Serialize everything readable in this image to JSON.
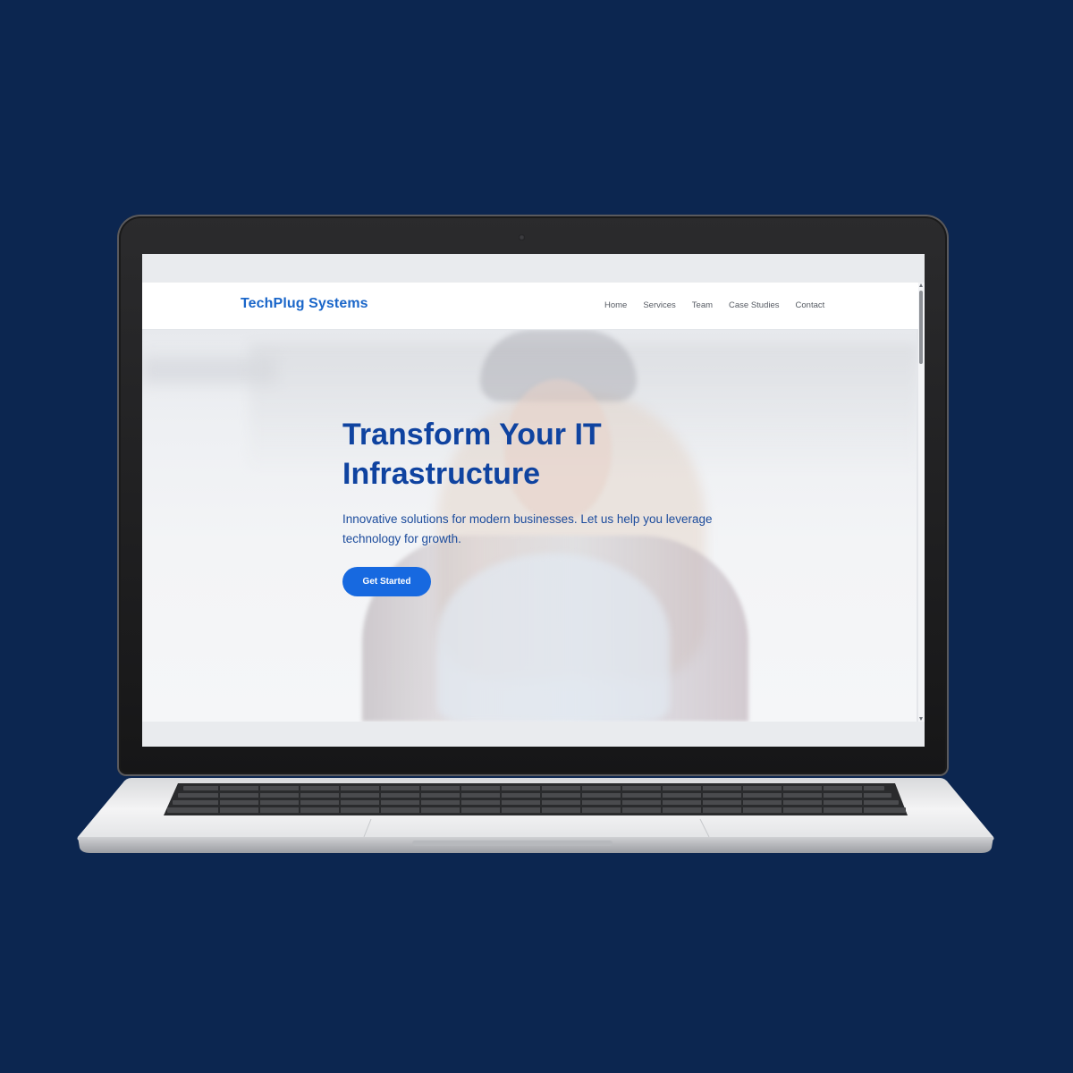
{
  "site": {
    "brand": "TechPlug Systems",
    "nav": [
      "Home",
      "Services",
      "Team",
      "Case Studies",
      "Contact"
    ]
  },
  "hero": {
    "title": "Transform Your IT Infrastructure",
    "subtitle": "Innovative solutions for modern businesses. Let us help you leverage technology for growth.",
    "cta_label": "Get Started"
  },
  "colors": {
    "page_background": "#0c2650",
    "brand": "#1a66c9",
    "hero_title": "#0f43a0",
    "cta": "#1769e0"
  }
}
